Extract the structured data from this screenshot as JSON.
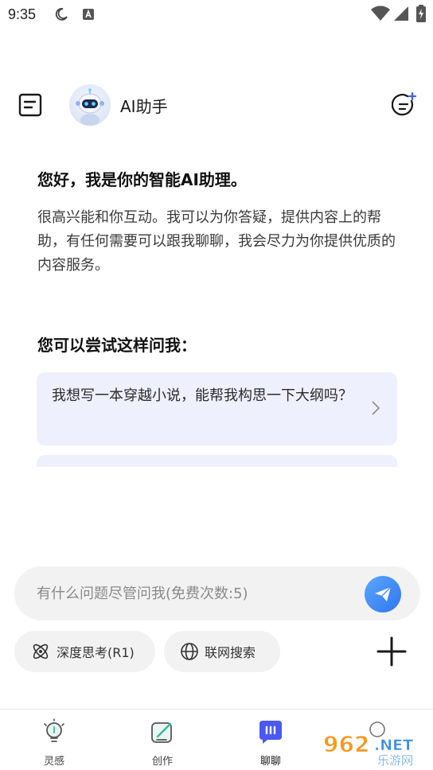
{
  "status_bar": {
    "time": "9:35"
  },
  "header": {
    "title": "AI助手"
  },
  "greeting": "您好，我是你的智能AI助理。",
  "intro": "很高兴能和你互动。我可以为你答疑，提供内容上的帮助，有任何需要可以跟我聊聊，我会尽力为你提供优质的内容服务。",
  "suggestions": {
    "title": "您可以尝试这样问我：",
    "items": [
      {
        "text": "我想写一本穿越小说，能帮我构思一下大纲吗？"
      },
      {
        "text": ""
      }
    ]
  },
  "input": {
    "placeholder": "有什么问题尽管问我(免费次数:5)",
    "value": ""
  },
  "chips": [
    {
      "label": "深度思考(R1)",
      "icon": "atom-icon"
    },
    {
      "label": "联网搜索",
      "icon": "globe-icon"
    }
  ],
  "bottom_nav": {
    "items": [
      {
        "label": "灵感",
        "icon": "lightbulb-icon",
        "active": false
      },
      {
        "label": "创作",
        "icon": "pen-icon",
        "active": false
      },
      {
        "label": "聊聊",
        "icon": "chat-icon",
        "active": true
      }
    ]
  },
  "watermark": {
    "brand": "962.NET",
    "sub": "乐游网"
  },
  "colors": {
    "accent": "#2f76f0",
    "card_bg": "#eef0fd",
    "chat_active": "#4b58f2"
  }
}
